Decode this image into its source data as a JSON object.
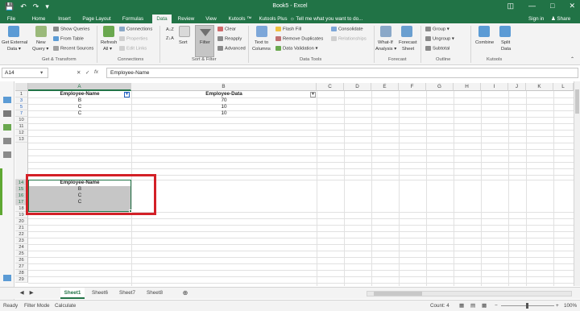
{
  "titlebar": {
    "title": "Book5 - Excel",
    "save_icon": "save-icon",
    "undo_icon": "undo-icon",
    "redo_icon": "redo-icon"
  },
  "tabs": [
    "File",
    "Home",
    "Insert",
    "Page Layout",
    "Formulas",
    "Data",
    "Review",
    "View",
    "Kutools ™",
    "Kutools Plus"
  ],
  "active_tab": "Data",
  "tell_me": "Tell me what you want to do...",
  "account": {
    "signin": "Sign in",
    "share": "Share"
  },
  "ribbon": {
    "get_external": "Get External",
    "get_external2": "Data ▾",
    "new_query": "New",
    "new_query2": "Query ▾",
    "show_queries": "Show Queries",
    "from_table": "From Table",
    "recent_sources": "Recent Sources",
    "get_transform": "Get & Transform",
    "refresh": "Refresh",
    "refresh2": "All ▾",
    "connections": "Connections",
    "properties": "Properties",
    "edit_links": "Edit Links",
    "connections_group": "Connections",
    "sort_az": "A↓Z",
    "sort_za": "Z↓A",
    "sort": "Sort",
    "filter": "Filter",
    "clear": "Clear",
    "reapply": "Reapply",
    "advanced": "Advanced",
    "sort_filter_group": "Sort & Filter",
    "text_to": "Text to",
    "columns": "Columns",
    "flash_fill": "Flash Fill",
    "remove_duplicates": "Remove Duplicates",
    "data_validation": "Data Validation ▾",
    "consolidate": "Consolidate",
    "relationships": "Relationships",
    "data_tools_group": "Data Tools",
    "whatif": "What-If",
    "analysis": "Analysis ▾",
    "forecast": "Forecast",
    "sheet": "Sheet",
    "forecast_group": "Forecast",
    "group": "Group ▾",
    "ungroup": "Ungroup ▾",
    "subtotal": "Subtotal",
    "outline_group": "Outline",
    "combine": "Combine",
    "split": "Split",
    "data": "Data",
    "kutools_group": "Kutools"
  },
  "formula_bar": {
    "name_box": "A14",
    "cancel": "✕",
    "enter": "✓",
    "fx": "fx",
    "content": "Employee-Name"
  },
  "columns": [
    "A",
    "B",
    "C",
    "D",
    "E",
    "F",
    "G",
    "H",
    "I",
    "J",
    "K",
    "L"
  ],
  "rows": [
    "1",
    "3",
    "5",
    "7",
    "10",
    "11",
    "12",
    "13",
    "14",
    "15",
    "16",
    "17",
    "18",
    "19",
    "20",
    "21",
    "22",
    "23",
    "24",
    "25",
    "26",
    "27",
    "28",
    "29"
  ],
  "table1": {
    "header_a": "Employee-Name",
    "header_b": "Employee-Data",
    "filter_icon": "filter-active-icon",
    "rows": [
      {
        "a": "B",
        "b": "70"
      },
      {
        "a": "C",
        "b": "10"
      },
      {
        "a": "C",
        "b": "10"
      }
    ]
  },
  "table2": {
    "header": "Employee-Name",
    "values": [
      "B",
      "C",
      "C"
    ]
  },
  "sheets": [
    "Sheet1",
    "Sheet6",
    "Sheet7",
    "Sheet8"
  ],
  "active_sheet": "Sheet1",
  "add_sheet": "⊕",
  "status": {
    "ready": "Ready",
    "mode": "Filter Mode",
    "calculate": "Calculate",
    "count": "Count: 4",
    "zoom": "100%"
  },
  "colors": {
    "excel_green": "#217346",
    "highlight_red": "#d32027",
    "selection_gray": "#c6c6c6"
  }
}
